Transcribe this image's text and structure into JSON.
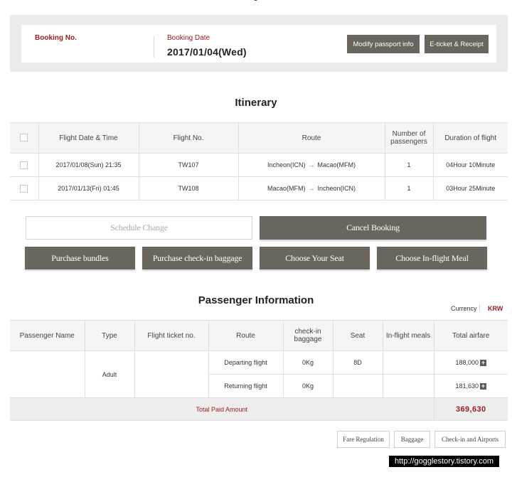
{
  "booking": {
    "no_label": "Booking No.",
    "date_label": "Booking Date",
    "date_value": "2017/01/04(Wed)",
    "modify_passport_label": "Modify passport info",
    "eticket_label": "E-ticket & Receipt"
  },
  "itinerary": {
    "title": "Itinerary",
    "headers": [
      "Flight Date & Time",
      "Flight No.",
      "Route",
      "Number of passengers",
      "Duration of flight"
    ],
    "rows": [
      {
        "date_time": "2017/01/08(Sun) 21:35",
        "flight_no": "TW107",
        "route_from": "Incheon(ICN)",
        "route_to": "Macao(MFM)",
        "passengers": "1",
        "duration": "04Hour 10Minute"
      },
      {
        "date_time": "2017/01/13(Fri) 01:45",
        "flight_no": "TW108",
        "route_from": "Macao(MFM)",
        "route_to": "Incheon(ICN)",
        "passengers": "1",
        "duration": "03Hour 25Minute"
      }
    ]
  },
  "actions": {
    "schedule_change": "Schedule Change",
    "cancel_booking": "Cancel Booking",
    "purchase_bundles": "Purchase bundles",
    "purchase_baggage": "Purchase check-in baggage",
    "choose_seat": "Choose Your Seat",
    "choose_meal": "Choose In-flight Meal"
  },
  "passenger": {
    "title": "Passenger Information",
    "currency_label": "Currency",
    "currency_value": "KRW",
    "headers": [
      "Passenger Name",
      "Type",
      "Flight ticket no.",
      "Route",
      "check-in baggage",
      "Seat",
      "In-flight meals",
      "Total airfare"
    ],
    "type": "Adult",
    "departing": {
      "route": "Departing flight",
      "baggage": "0Kg",
      "seat": "8D",
      "fare": "188,000"
    },
    "returning": {
      "route": "Returning flight",
      "baggage": "0Kg",
      "seat": "",
      "fare": "181,630"
    },
    "total_label": "Total Paid Amount",
    "total_value": "369,630"
  },
  "footer": {
    "fare_regulation": "Fare Regulation",
    "baggage": "Baggage",
    "checkin_airports": "Check-in and Airports",
    "watermark": "http://gogglestory.tistory.com"
  },
  "colors": {
    "accent": "#9c1c22",
    "button_dark": "#6b6560",
    "panel_bg": "#ebebeb"
  },
  "icons": {
    "plus": "+",
    "arrow": "→"
  }
}
